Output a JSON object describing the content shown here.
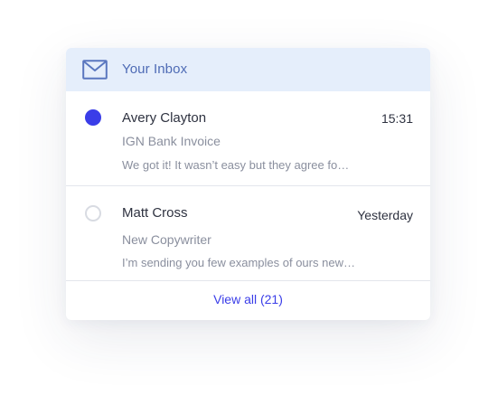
{
  "inbox": {
    "title": "Your Inbox",
    "icon": "envelope-icon",
    "header_bg": "#e5eefb",
    "accent": "#3a3de8"
  },
  "messages": [
    {
      "sender": "Avery Clayton",
      "time": "15:31",
      "subject": "IGN Bank Invoice",
      "preview": "We got it! It wasn’t easy but they agree fo…",
      "unread": true
    },
    {
      "sender": "Matt Cross",
      "time": "Yesterday",
      "subject": "New Copywriter",
      "preview": "I’m sending you few examples of ours new…",
      "unread": false
    }
  ],
  "footer": {
    "view_all_label": "View all (21)"
  }
}
